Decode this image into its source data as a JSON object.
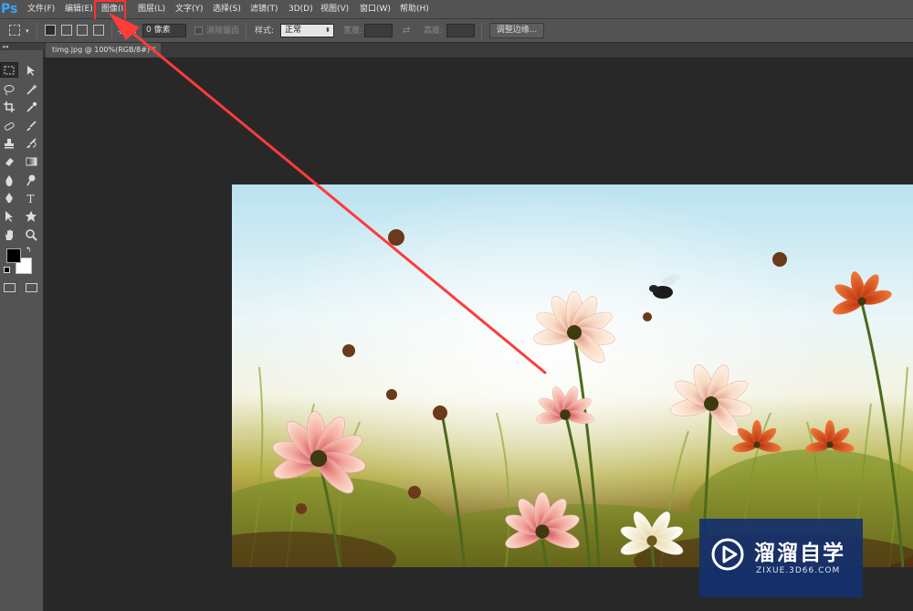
{
  "app": {
    "logo": "Ps"
  },
  "menu": {
    "file": "文件(F)",
    "edit": "编辑(E)",
    "image": "图像(I)",
    "layer": "图层(L)",
    "type": "文字(Y)",
    "select": "选择(S)",
    "filter": "滤镜(T)",
    "threed": "3D(D)",
    "view": "视图(V)",
    "window": "窗口(W)",
    "help": "帮助(H)"
  },
  "options": {
    "feather_label": "羽化:",
    "feather_value": "0 像素",
    "antialias_label": "消除锯齿",
    "style_label": "样式:",
    "style_value": "正常",
    "width_label": "宽度:",
    "height_label": "高度:",
    "refine_edge_button": "调整边缘..."
  },
  "document": {
    "tab_title": "timg.jpg @ 100%(RGB/8#)",
    "close_glyph": "×"
  },
  "toolbox": {
    "grip": "◂◂",
    "tools": [
      "rectangular-marquee",
      "move",
      "lasso",
      "magic-wand",
      "crop",
      "eyedropper",
      "spot-healing-brush",
      "brush",
      "clone-stamp",
      "history-brush",
      "eraser",
      "gradient",
      "blur",
      "dodge",
      "pen",
      "type",
      "path-selection",
      "custom-shape",
      "hand",
      "zoom"
    ],
    "foreground_color": "#000000",
    "background_color": "#ffffff"
  },
  "annotation": {
    "arrow_color": "#ff3b3b"
  },
  "watermark": {
    "title": "溜溜自学",
    "url": "ZIXUE.3D66.COM"
  }
}
